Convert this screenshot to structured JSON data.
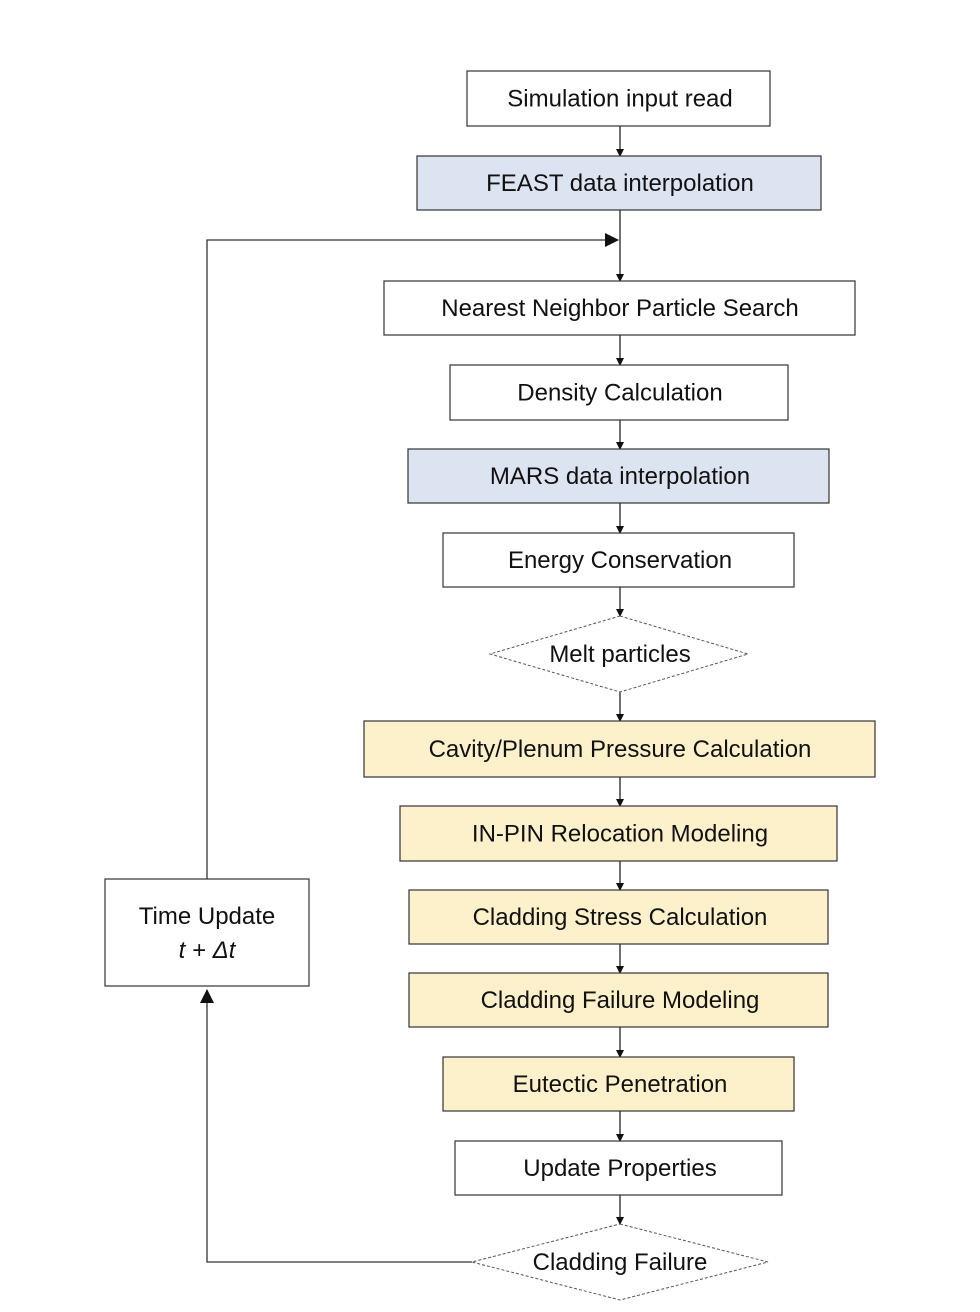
{
  "colors": {
    "white": "#ffffff",
    "blue": "#dde4f1",
    "yellow": "#fdf1cb"
  },
  "steps": [
    {
      "label": "Simulation input read",
      "fill": "white"
    },
    {
      "label": "FEAST data interpolation",
      "fill": "blue"
    },
    {
      "label": "Nearest Neighbor Particle Search",
      "fill": "white"
    },
    {
      "label": "Density Calculation",
      "fill": "white"
    },
    {
      "label": "MARS data interpolation",
      "fill": "blue"
    },
    {
      "label": "Energy Conservation",
      "fill": "white"
    },
    {
      "label": "Melt particles",
      "shape": "diamond"
    },
    {
      "label": "Cavity/Plenum Pressure Calculation",
      "fill": "yellow"
    },
    {
      "label": "IN-PIN Relocation Modeling",
      "fill": "yellow"
    },
    {
      "label": "Cladding Stress Calculation",
      "fill": "yellow"
    },
    {
      "label": "Cladding Failure Modeling",
      "fill": "yellow"
    },
    {
      "label": "Eutectic Penetration",
      "fill": "yellow"
    },
    {
      "label": "Update Properties",
      "fill": "white"
    },
    {
      "label": "Cladding Failure",
      "shape": "diamond"
    }
  ],
  "time_update": {
    "title": "Time Update",
    "formula": "t + Δt"
  }
}
